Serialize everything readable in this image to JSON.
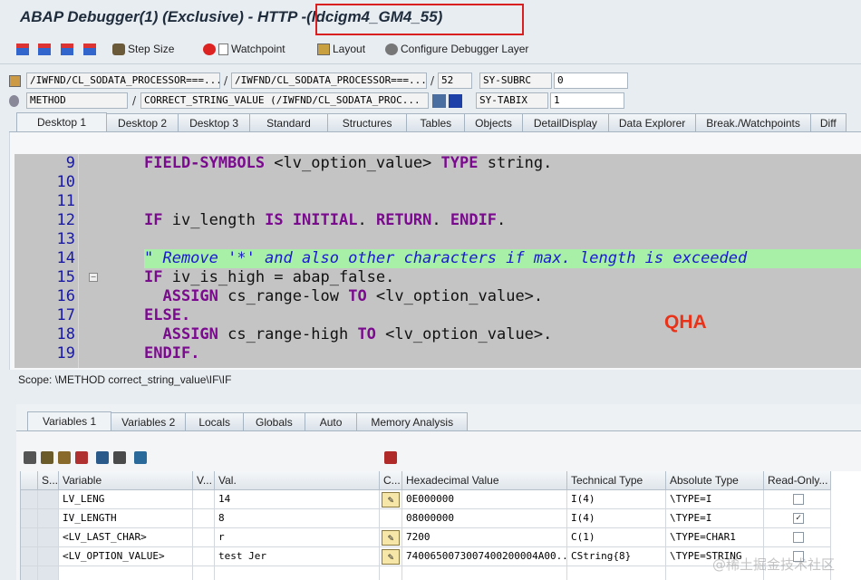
{
  "window": {
    "title": "ABAP Debugger(1)  (Exclusive) - HTTP -(ldcigm4_GM4_55)"
  },
  "toolbar": {
    "step_size": "Step Size",
    "watchpoint": "Watchpoint",
    "layout": "Layout",
    "configure": "Configure Debugger Layer"
  },
  "fields": {
    "row1": {
      "f1": "/IWFND/CL_SODATA_PROCESSOR===...",
      "f2": "/IWFND/CL_SODATA_PROCESSOR===...",
      "line": "52",
      "sysname": "SY-SUBRC",
      "sysval": "0"
    },
    "row2": {
      "f1": "METHOD",
      "f2": "CORRECT_STRING_VALUE (/IWFND/CL_SODATA_PROC...",
      "sysname": "SY-TABIX",
      "sysval": "1"
    }
  },
  "desktop_tabs": [
    "Desktop 1",
    "Desktop 2",
    "Desktop 3",
    "Standard",
    "Structures",
    "Tables",
    "Objects",
    "DetailDisplay",
    "Data Explorer",
    "Break./Watchpoints",
    "Diff"
  ],
  "code_lines": [
    {
      "no": "9",
      "text": "FIELD-SYMBOLS <lv_option_value> TYPE string."
    },
    {
      "no": "10",
      "text": ""
    },
    {
      "no": "11",
      "text": ""
    },
    {
      "no": "12",
      "text": "IF iv_length IS INITIAL. RETURN. ENDIF."
    },
    {
      "no": "13",
      "text": ""
    },
    {
      "no": "14",
      "text": "\" Remove '*' and also other characters if max. length is exceeded"
    },
    {
      "no": "15",
      "text": "IF iv_is_high = abap_false."
    },
    {
      "no": "16",
      "text": "  ASSIGN cs_range-low TO <lv_option_value>."
    },
    {
      "no": "17",
      "text": "ELSE."
    },
    {
      "no": "18",
      "text": "  ASSIGN cs_range-high TO <lv_option_value>."
    },
    {
      "no": "19",
      "text": "ENDIF."
    }
  ],
  "annotation": "QHA",
  "scope": "Scope: \\METHOD correct_string_value\\IF\\IF",
  "var_tabs": [
    "Variables 1",
    "Variables 2",
    "Locals",
    "Globals",
    "Auto",
    "Memory Analysis"
  ],
  "grid": {
    "headers": [
      "S...",
      "Variable",
      "V...",
      "Val.",
      "C...",
      "Hexadecimal Value",
      "Technical Type",
      "Absolute Type",
      "Read-Only..."
    ],
    "rows": [
      {
        "variable": "LV_LENG",
        "val": "14",
        "hex": "0E000000",
        "tech": "I(4)",
        "abs": "\\TYPE=I",
        "ro": false,
        "edit": true
      },
      {
        "variable": "IV_LENGTH",
        "val": "8",
        "hex": "08000000",
        "tech": "I(4)",
        "abs": "\\TYPE=I",
        "ro": true,
        "edit": false
      },
      {
        "variable": "<LV_LAST_CHAR>",
        "val": "r",
        "hex": "7200",
        "tech": "C(1)",
        "abs": "\\TYPE=CHAR1",
        "ro": false,
        "edit": true
      },
      {
        "variable": "<LV_OPTION_VALUE>",
        "val": "test Jer",
        "hex": "7400650073007400200004A00...",
        "tech": "CString{8}",
        "abs": "\\TYPE=STRING",
        "ro": false,
        "edit": true
      }
    ]
  },
  "watermark": "@稀土掘金技术社区"
}
